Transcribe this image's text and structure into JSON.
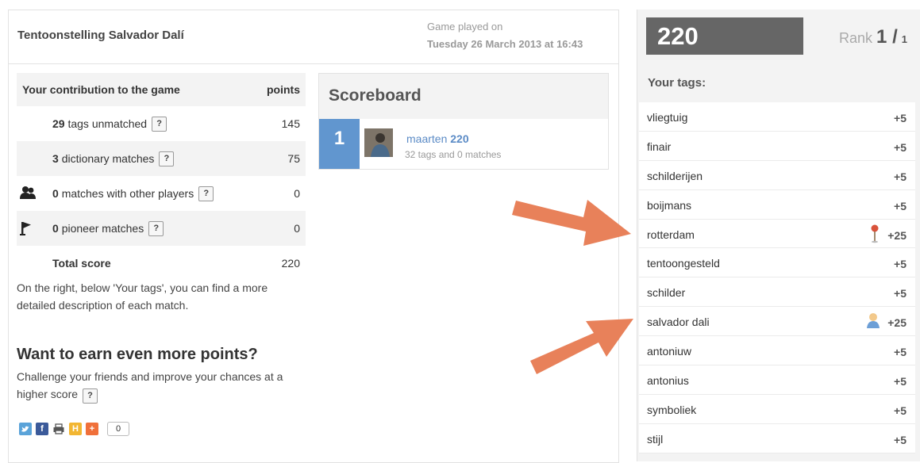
{
  "game": {
    "title": "Tentoonstelling Salvador Dalí",
    "played_label": "Game played on",
    "played_date": "Tuesday 26 March 2013 at 16:43"
  },
  "contribution": {
    "header_label": "Your contribution to the game",
    "header_points": "points",
    "rows": [
      {
        "count": "29",
        "label": "tags unmatched",
        "points": "145",
        "icon": "none"
      },
      {
        "count": "3",
        "label": "dictionary matches",
        "points": "75",
        "icon": "none"
      },
      {
        "count": "0",
        "label": "matches with other players",
        "points": "0",
        "icon": "people-icon"
      },
      {
        "count": "0",
        "label": "pioneer matches",
        "points": "0",
        "icon": "flag-icon"
      }
    ],
    "total_label": "Total score",
    "total_value": "220",
    "help_glyph": "?"
  },
  "note": "On the right, below 'Your tags', you can find a more detailed description of each match.",
  "earn": {
    "title": "Want to earn even more points?",
    "text": "Challenge your friends and improve your chances at a higher score"
  },
  "share": {
    "icons": [
      "twitter-icon",
      "facebook-icon",
      "print-icon",
      "hyves-icon",
      "addthis-icon"
    ],
    "count": "0"
  },
  "scoreboard": {
    "title": "Scoreboard",
    "rank": "1",
    "player_name": "maarten",
    "player_score": "220",
    "summary": "32 tags and 0 matches"
  },
  "right": {
    "score": "220",
    "rank_label": "Rank",
    "rank_value": "1 /",
    "rank_total": "1",
    "tags_title": "Your tags:",
    "tags": [
      {
        "name": "vliegtuig",
        "points": "+5",
        "icon": ""
      },
      {
        "name": "finair",
        "points": "+5",
        "icon": ""
      },
      {
        "name": "schilderijen",
        "points": "+5",
        "icon": ""
      },
      {
        "name": "boijmans",
        "points": "+5",
        "icon": ""
      },
      {
        "name": "rotterdam",
        "points": "+25",
        "icon": "pin-icon"
      },
      {
        "name": "tentoongesteld",
        "points": "+5",
        "icon": ""
      },
      {
        "name": "schilder",
        "points": "+5",
        "icon": ""
      },
      {
        "name": "salvador dali",
        "points": "+25",
        "icon": "person-icon"
      },
      {
        "name": "antoniuw",
        "points": "+5",
        "icon": ""
      },
      {
        "name": "antonius",
        "points": "+5",
        "icon": ""
      },
      {
        "name": "symboliek",
        "points": "+5",
        "icon": ""
      },
      {
        "name": "stijl",
        "points": "+5",
        "icon": ""
      }
    ]
  },
  "colors": {
    "accent_blue": "#6196cf",
    "score_box": "#666666",
    "arrow": "#e8815a"
  }
}
